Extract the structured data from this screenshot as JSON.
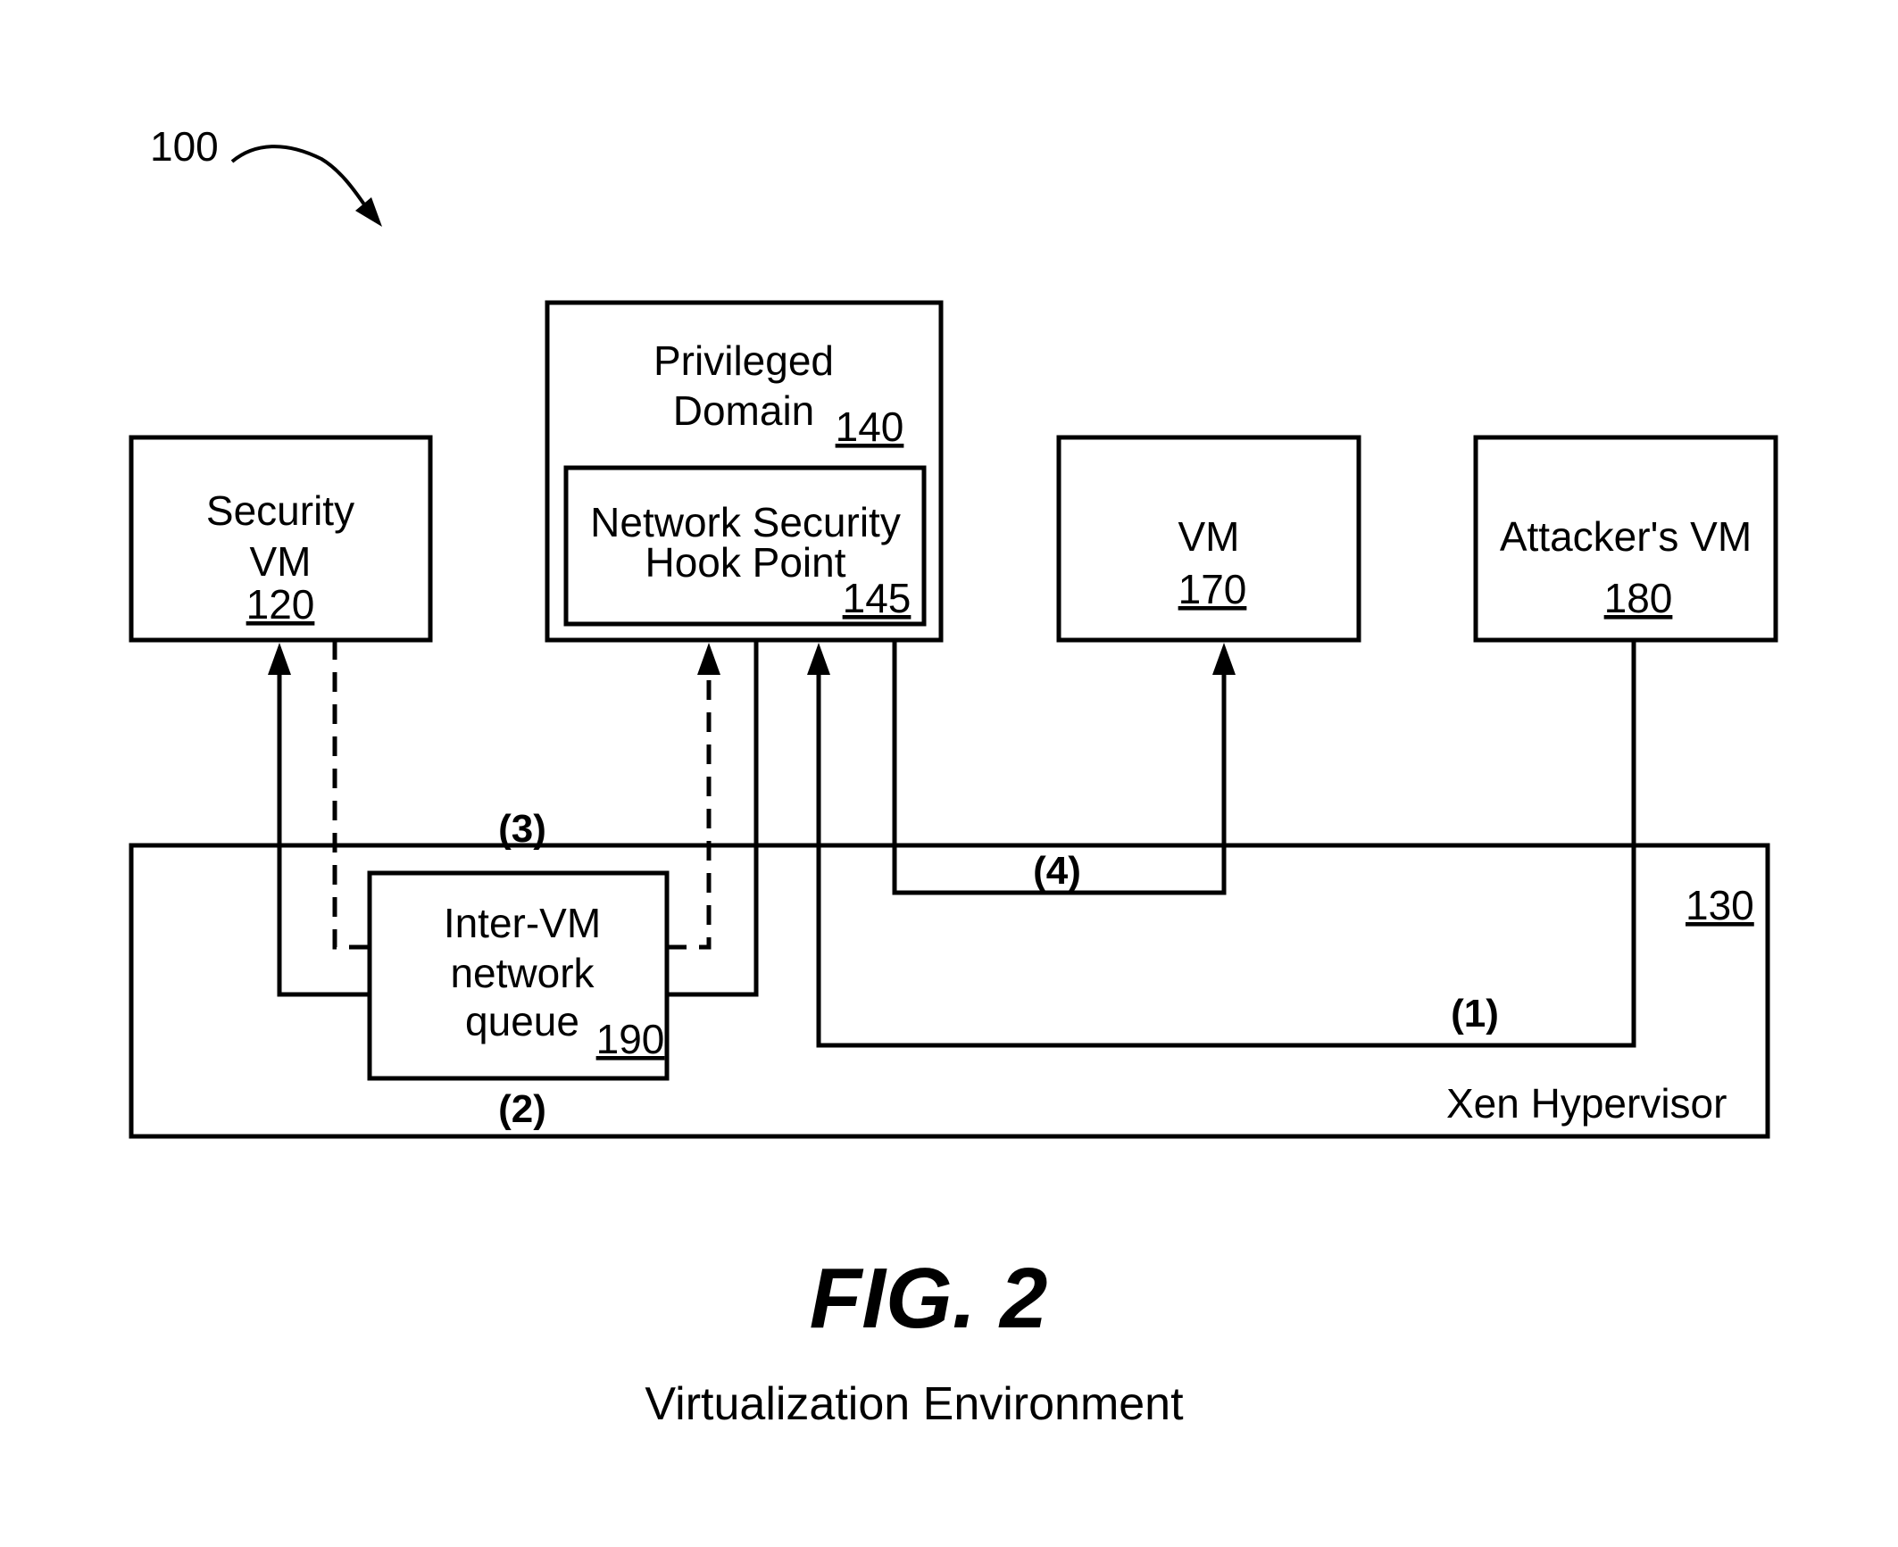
{
  "figure": {
    "ref_label": "100",
    "title": "FIG. 2",
    "caption": "Virtualization Environment"
  },
  "components": {
    "security_vm": {
      "lines": [
        "Security",
        "VM"
      ],
      "ref": "120"
    },
    "privileged_domain": {
      "lines": [
        "Privileged",
        "Domain"
      ],
      "ref": "140"
    },
    "hook_point": {
      "lines": [
        "Network Security",
        "Hook Point"
      ],
      "ref": "145"
    },
    "vm": {
      "lines": [
        "VM"
      ],
      "ref": "170"
    },
    "attacker_vm": {
      "lines": [
        "Attacker's VM"
      ],
      "ref": "180"
    },
    "queue": {
      "lines": [
        "Inter-VM",
        "network",
        "queue"
      ],
      "ref": "190"
    },
    "hypervisor": {
      "label": "Xen Hypervisor",
      "ref": "130"
    }
  },
  "steps": [
    "(1)",
    "(2)",
    "(3)",
    "(4)"
  ]
}
